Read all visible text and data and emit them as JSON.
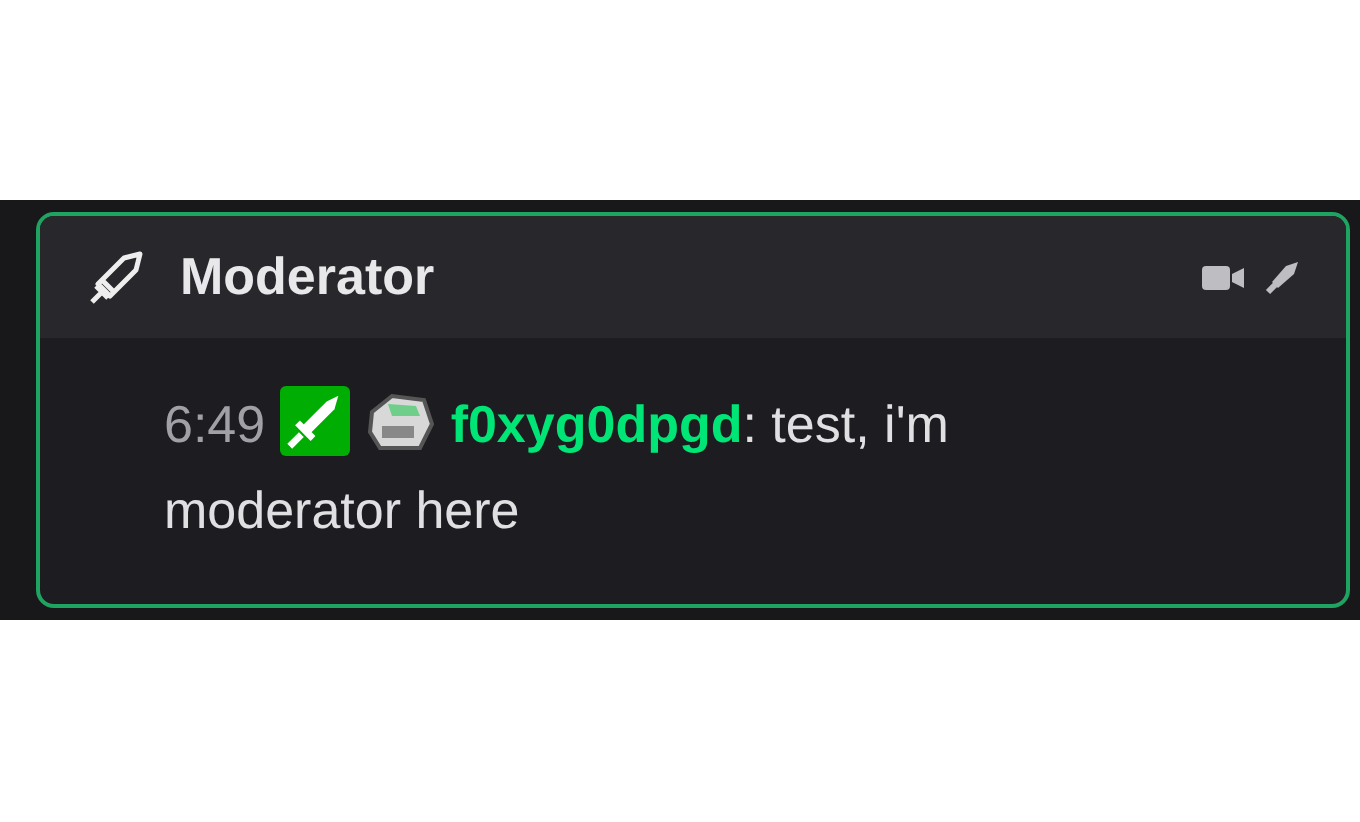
{
  "card": {
    "title": "Moderator",
    "highlighted": true
  },
  "message": {
    "time": "6:49",
    "badges": [
      {
        "kind": "moderator"
      },
      {
        "kind": "bot"
      }
    ],
    "username": "f0xyg0dpgd",
    "text_lines": [
      ": test, i'm",
      "moderator here"
    ]
  }
}
